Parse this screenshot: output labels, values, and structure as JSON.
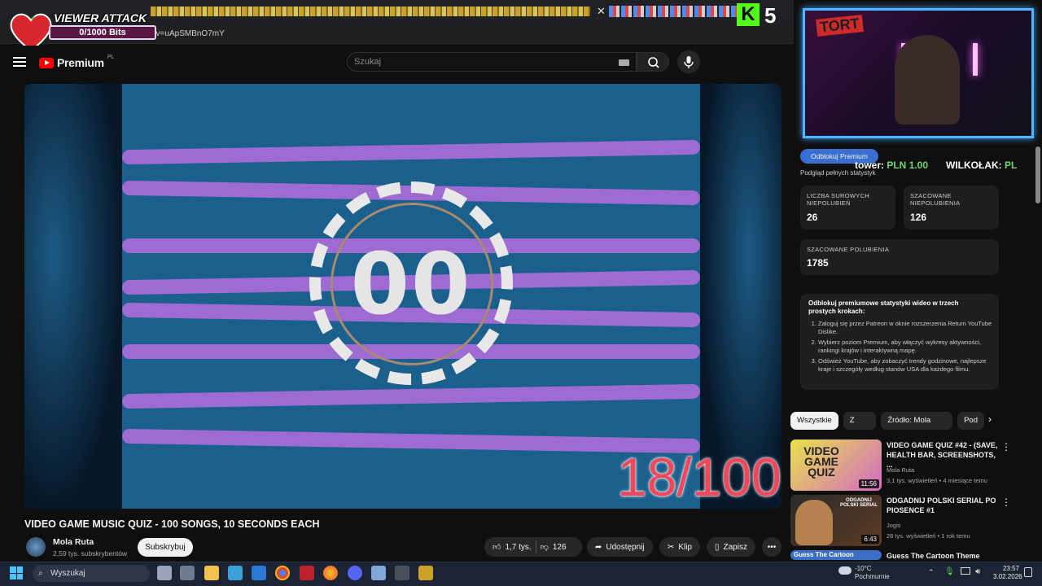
{
  "browser": {
    "url_fragment": "?v=uApSMBnO7mY"
  },
  "overlay": {
    "viewer_attack_title": "VIEWER ATTACK",
    "bits_progress": "0/1000 Bits",
    "kick_letter": "K",
    "kick_count": "5"
  },
  "youtube_header": {
    "logo_text": "Premium",
    "logo_region": "PL",
    "search_placeholder": "Szukaj"
  },
  "video": {
    "timer_digits": "00",
    "question_counter": "18/100",
    "title": "VIDEO GAME MUSIC QUIZ - 100 SONGS, 10 SECONDS EACH",
    "channel_name": "Mola Ruta",
    "subscribers": "2,59 tys. subskrybentów",
    "subscribe_label": "Subskrybuj",
    "like_count": "1,7 tys.",
    "dislike_count": "126",
    "share_label": "Udostępnij",
    "clip_label": "Klip",
    "save_label": "Zapisz"
  },
  "webcam": {
    "overlay_logo": "TORT"
  },
  "ticker": {
    "item1_name": "tower:",
    "item1_value": "PLN 1.00",
    "item2_name": "WILKOŁAK:",
    "item2_value": "PL"
  },
  "dislike_panel": {
    "unlock_button": "Odblokuj Premium",
    "full_stats_caption": "Podgląd pełnych statystyk",
    "raw_dislikes_label": "LICZBA SUROWYCH NIEPOLUBIEŃ",
    "raw_dislikes_value": "26",
    "est_dislikes_label": "SZACOWANE NIEPOLUBIENIA",
    "est_dislikes_value": "126",
    "est_likes_label": "SZACOWANE POLUBIENIA",
    "est_likes_value": "1785",
    "steps_heading": "Odblokuj premiumowe statystyki wideo w trzech prostych krokach:",
    "steps": [
      "Zaloguj się przez Patreon w oknie rozszerzenia Return YouTube Dislike.",
      "Wybierz poziom Premium, aby włączyć wykresy aktywności, rankingi krajów i interaktywną mapę.",
      "Odśwież YouTube, aby zobaczyć trendy godzinowe, najlepsze kraje i szczegóły według stanów USA dla każdego filmu."
    ]
  },
  "chips": [
    "Wszystkie",
    "Z serii",
    "Źródło: Mola Ruta",
    "Pod"
  ],
  "recommendations": [
    {
      "thumb_text": "VIDEO GAME QUIZ",
      "duration": "11:56",
      "title": "VIDEO GAME QUIZ #42 - (SAVE, HEALTH BAR, SCREENSHOTS, ...",
      "channel": "Mola Ruta",
      "meta": "3,1 tys. wyświetleń • 4 miesiące temu"
    },
    {
      "thumb_text": "ODGADNIJ POLSKI SERIAL",
      "duration": "6:43",
      "title": "ODGADNIJ POLSKI SERIAL PO PIOSENCE #1",
      "channel": "Jogis",
      "meta": "28 tys. wyświetleń • 1 rok temu"
    },
    {
      "thumb_text": "Guess The Cartoon",
      "title": "Guess The Cartoon Theme"
    }
  ],
  "taskbar": {
    "search_placeholder": "Wyszukaj",
    "weather_temp": "-10°C",
    "weather_desc": "Pochmurnie",
    "time": "23:57",
    "date": "3.02.2026"
  }
}
